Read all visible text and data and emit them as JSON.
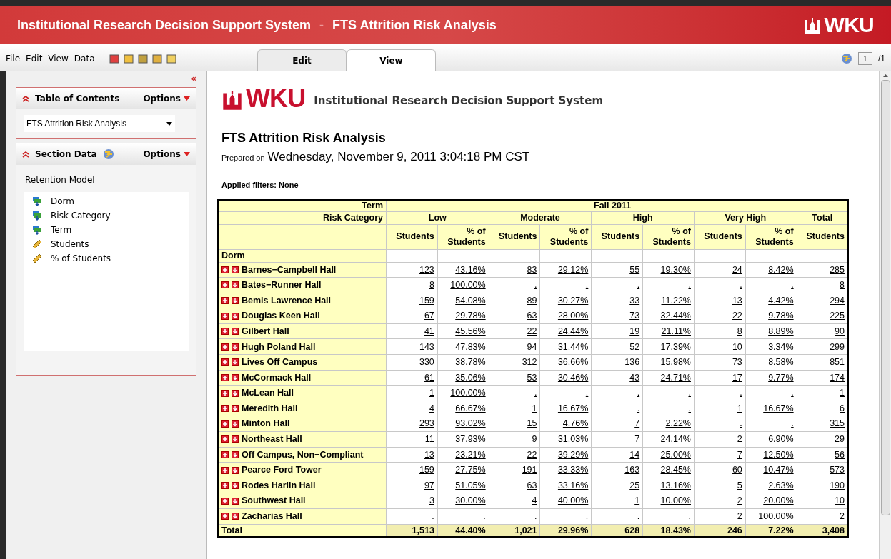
{
  "header": {
    "app_title": "Institutional Research Decision Support System",
    "separator": "-",
    "report_title": "FTS Attrition Risk Analysis",
    "logo": "WKU"
  },
  "menu": [
    "File",
    "Edit",
    "View",
    "Data"
  ],
  "tabs": [
    {
      "label": "Edit",
      "selected": false
    },
    {
      "label": "View",
      "selected": true
    }
  ],
  "pager": {
    "value": "1",
    "total": "/1"
  },
  "collapse_panel": "«",
  "toc": {
    "title": "Table of Contents",
    "options": "Options",
    "dropdown": "FTS Attrition Risk Analysis"
  },
  "section_data": {
    "title": "Section Data",
    "options": "Options",
    "model": "Retention Model",
    "items": [
      {
        "kind": "category",
        "label": "Dorm"
      },
      {
        "kind": "category",
        "label": "Risk Category"
      },
      {
        "kind": "category",
        "label": "Term"
      },
      {
        "kind": "measure",
        "label": "Students"
      },
      {
        "kind": "measure",
        "label": "% of Students"
      }
    ]
  },
  "report": {
    "logo": "WKU",
    "org": "Institutional Research Decision Support System",
    "title": "FTS Attrition Risk Analysis",
    "prepared_label": "Prepared on",
    "prepared_date": "Wednesday, November 9, 2011 3:04:18 PM CST",
    "filters": "Applied filters: None"
  },
  "table": {
    "term_label": "Term",
    "term": "Fall 2011",
    "risk_label": "Risk Category",
    "groups": [
      {
        "label": "Low",
        "kind": "risk"
      },
      {
        "label": "Moderate",
        "kind": "risk"
      },
      {
        "label": "High",
        "kind": "risk"
      },
      {
        "label": "Very High",
        "kind": "risk"
      },
      {
        "label": "Total",
        "kind": "total"
      }
    ],
    "columns": [
      "Students",
      "% of Students",
      "Students",
      "% of Students",
      "Students",
      "% of Students",
      "Students",
      "% of Students",
      "Students"
    ],
    "dorm_label": "Dorm",
    "rows": [
      {
        "name": "Barnes−Campbell Hall",
        "cells": [
          "123",
          "43.16%",
          "83",
          "29.12%",
          "55",
          "19.30%",
          "24",
          "8.42%",
          "285"
        ]
      },
      {
        "name": "Bates−Runner Hall",
        "cells": [
          "8",
          "100.00%",
          ".",
          ".",
          ".",
          ".",
          ".",
          ".",
          "8"
        ]
      },
      {
        "name": "Bemis Lawrence Hall",
        "cells": [
          "159",
          "54.08%",
          "89",
          "30.27%",
          "33",
          "11.22%",
          "13",
          "4.42%",
          "294"
        ]
      },
      {
        "name": "Douglas Keen Hall",
        "cells": [
          "67",
          "29.78%",
          "63",
          "28.00%",
          "73",
          "32.44%",
          "22",
          "9.78%",
          "225"
        ]
      },
      {
        "name": "Gilbert Hall",
        "cells": [
          "41",
          "45.56%",
          "22",
          "24.44%",
          "19",
          "21.11%",
          "8",
          "8.89%",
          "90"
        ]
      },
      {
        "name": "Hugh Poland Hall",
        "cells": [
          "143",
          "47.83%",
          "94",
          "31.44%",
          "52",
          "17.39%",
          "10",
          "3.34%",
          "299"
        ]
      },
      {
        "name": "Lives Off Campus",
        "cells": [
          "330",
          "38.78%",
          "312",
          "36.66%",
          "136",
          "15.98%",
          "73",
          "8.58%",
          "851"
        ]
      },
      {
        "name": "McCormack Hall",
        "cells": [
          "61",
          "35.06%",
          "53",
          "30.46%",
          "43",
          "24.71%",
          "17",
          "9.77%",
          "174"
        ]
      },
      {
        "name": "McLean Hall",
        "cells": [
          "1",
          "100.00%",
          ".",
          ".",
          ".",
          ".",
          ".",
          ".",
          "1"
        ]
      },
      {
        "name": "Meredith Hall",
        "cells": [
          "4",
          "66.67%",
          "1",
          "16.67%",
          ".",
          ".",
          "1",
          "16.67%",
          "6"
        ]
      },
      {
        "name": "Minton Hall",
        "cells": [
          "293",
          "93.02%",
          "15",
          "4.76%",
          "7",
          "2.22%",
          ".",
          ".",
          "315"
        ]
      },
      {
        "name": "Northeast Hall",
        "cells": [
          "11",
          "37.93%",
          "9",
          "31.03%",
          "7",
          "24.14%",
          "2",
          "6.90%",
          "29"
        ]
      },
      {
        "name": "Off Campus, Non−Compliant",
        "cells": [
          "13",
          "23.21%",
          "22",
          "39.29%",
          "14",
          "25.00%",
          "7",
          "12.50%",
          "56"
        ]
      },
      {
        "name": "Pearce Ford Tower",
        "cells": [
          "159",
          "27.75%",
          "191",
          "33.33%",
          "163",
          "28.45%",
          "60",
          "10.47%",
          "573"
        ]
      },
      {
        "name": "Rodes Harlin Hall",
        "cells": [
          "97",
          "51.05%",
          "63",
          "33.16%",
          "25",
          "13.16%",
          "5",
          "2.63%",
          "190"
        ]
      },
      {
        "name": "Southwest Hall",
        "cells": [
          "3",
          "30.00%",
          "4",
          "40.00%",
          "1",
          "10.00%",
          "2",
          "20.00%",
          "10"
        ]
      },
      {
        "name": "Zacharias Hall",
        "cells": [
          ".",
          ".",
          ".",
          ".",
          ".",
          ".",
          "2",
          "100.00%",
          "2"
        ]
      }
    ],
    "total": {
      "label": "Total",
      "cells": [
        "1,513",
        "44.40%",
        "1,021",
        "29.96%",
        "628",
        "18.43%",
        "246",
        "7.22%",
        "3,408"
      ]
    }
  }
}
